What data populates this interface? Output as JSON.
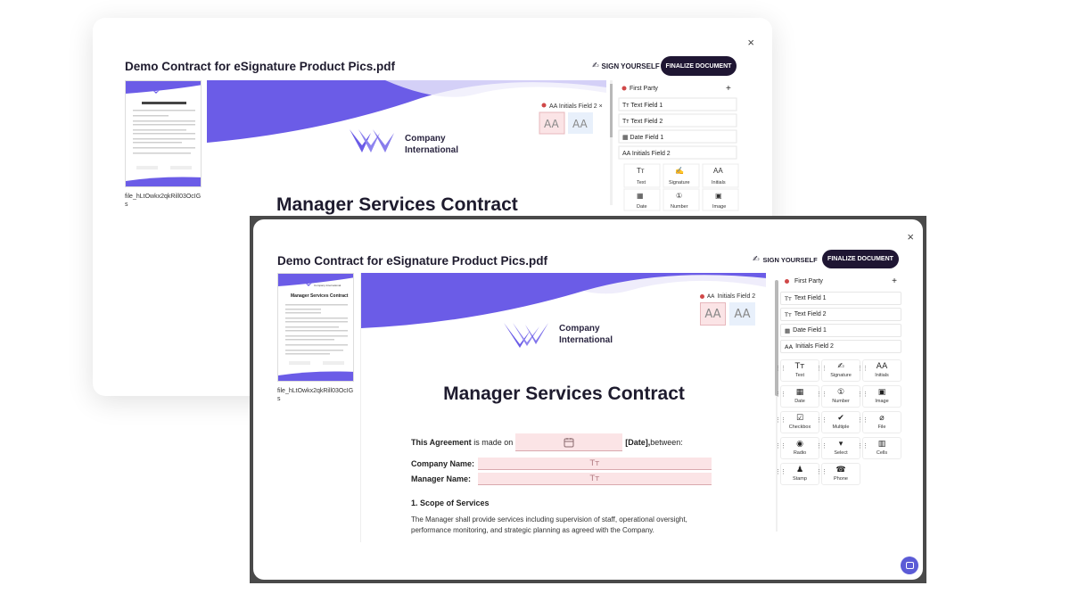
{
  "window": {
    "close_icon": "×",
    "title": "Demo Contract for eSignature Product Pics.pdf",
    "sign_yourself_label": "SIGN YOURSELF",
    "finalize_label": "FINALIZE DOCUMENT"
  },
  "sidebar": {
    "file_name": "file_hLtOwkx2qkRill03OcIGs"
  },
  "document": {
    "company_line1": "Company",
    "company_line2": "International",
    "heading": "Manager Services Contract",
    "agreement_bold": "This Agreement",
    "agreement_text": "is made on",
    "date_label": "[Date],",
    "between_text": "between:",
    "company_name_label": "Company Name:",
    "manager_name_label": "Manager Name:",
    "text_field_glyph": "Tт",
    "scope_heading": "1. Scope of Services",
    "scope_text": "The Manager shall provide services including supervision of staff, operational oversight, performance monitoring, and strategic planning as agreed with the Company.",
    "initials_label": "Initials Field 2",
    "initials_glyph": "AA"
  },
  "panel": {
    "party": "First Party",
    "add_icon": "+",
    "fields": [
      {
        "icon": "Tт",
        "label": "Text Field 1"
      },
      {
        "icon": "Tт",
        "label": "Text Field 2"
      },
      {
        "icon": "▦",
        "label": "Date Field 1"
      },
      {
        "icon": "AA",
        "label": "Initials Field 2"
      }
    ],
    "tools": [
      {
        "icon": "Tт",
        "label": "Text"
      },
      {
        "icon": "✍",
        "label": "Signature"
      },
      {
        "icon": "AA",
        "label": "Initials"
      },
      {
        "icon": "▦",
        "label": "Date"
      },
      {
        "icon": "①",
        "label": "Number"
      },
      {
        "icon": "▣",
        "label": "Image"
      },
      {
        "icon": "☑",
        "label": "Checkbox"
      },
      {
        "icon": "✔",
        "label": "Multiple"
      },
      {
        "icon": "⌀",
        "label": "File"
      },
      {
        "icon": "◉",
        "label": "Radio"
      },
      {
        "icon": "▾",
        "label": "Select"
      },
      {
        "icon": "▥",
        "label": "Cells"
      },
      {
        "icon": "♟",
        "label": "Stamp"
      },
      {
        "icon": "☎",
        "label": "Phone"
      }
    ]
  },
  "colors": {
    "accent": "#6b5ce7",
    "finalize_bg": "#1f1633",
    "field_pink": "#fbe4e6"
  }
}
